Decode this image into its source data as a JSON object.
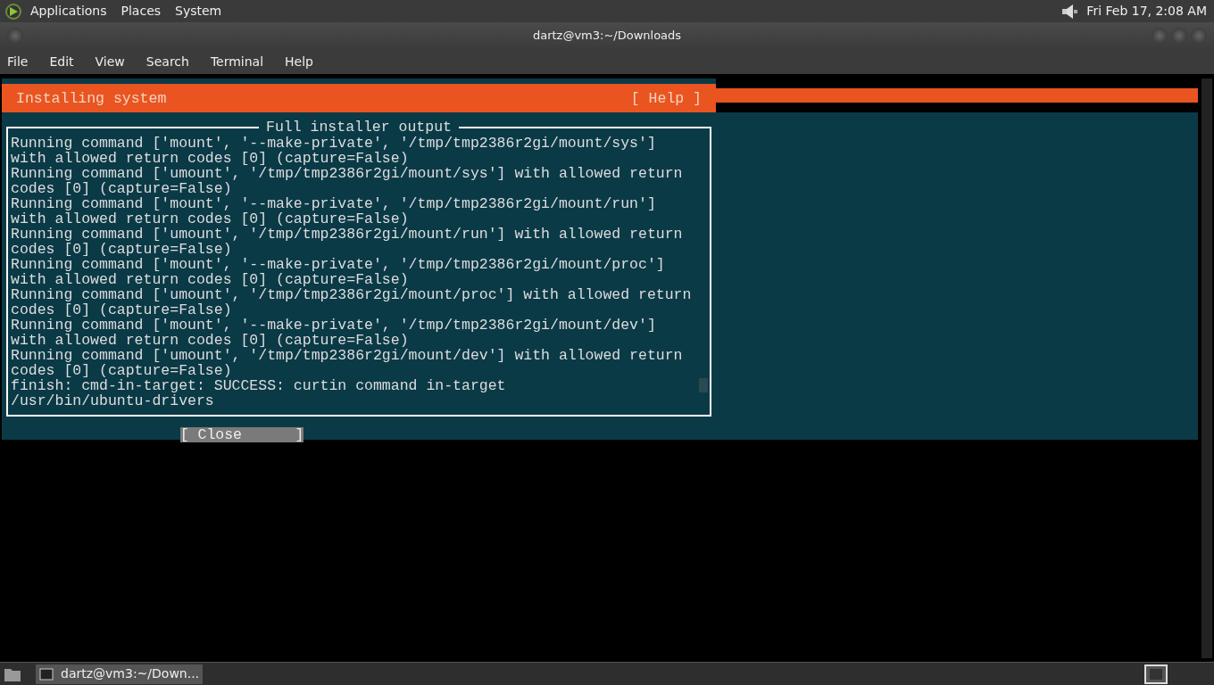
{
  "top_panel": {
    "menus": [
      "Applications",
      "Places",
      "System"
    ],
    "clock": "Fri Feb 17, 2:08 AM"
  },
  "window": {
    "title": "dartz@vm3:~/Downloads",
    "menus": [
      "File",
      "Edit",
      "View",
      "Search",
      "Terminal",
      "Help"
    ]
  },
  "installer": {
    "title": "Installing system",
    "help_button": "[ Help ]",
    "dialog": {
      "title": "Full installer output",
      "lines": [
        "Running command ['mount', '--make-private', '/tmp/tmp2386r2gi/mount/sys']",
        "with allowed return codes [0] (capture=False)",
        "Running command ['umount', '/tmp/tmp2386r2gi/mount/sys'] with allowed return",
        "codes [0] (capture=False)",
        "Running command ['mount', '--make-private', '/tmp/tmp2386r2gi/mount/run']",
        "with allowed return codes [0] (capture=False)",
        "Running command ['umount', '/tmp/tmp2386r2gi/mount/run'] with allowed return",
        "codes [0] (capture=False)",
        "Running command ['mount', '--make-private', '/tmp/tmp2386r2gi/mount/proc']",
        "with allowed return codes [0] (capture=False)",
        "Running command ['umount', '/tmp/tmp2386r2gi/mount/proc'] with allowed return",
        "codes [0] (capture=False)",
        "Running command ['mount', '--make-private', '/tmp/tmp2386r2gi/mount/dev']",
        "with allowed return codes [0] (capture=False)",
        "Running command ['umount', '/tmp/tmp2386r2gi/mount/dev'] with allowed return",
        "codes [0] (capture=False)",
        "finish: cmd-in-target: SUCCESS: curtin command in-target",
        "/usr/bin/ubuntu-drivers"
      ],
      "close_button": "[ Close      ]"
    }
  },
  "taskbar": {
    "tasks": [
      {
        "label": "dartz@vm3:~/Down...",
        "selected": true
      }
    ]
  }
}
